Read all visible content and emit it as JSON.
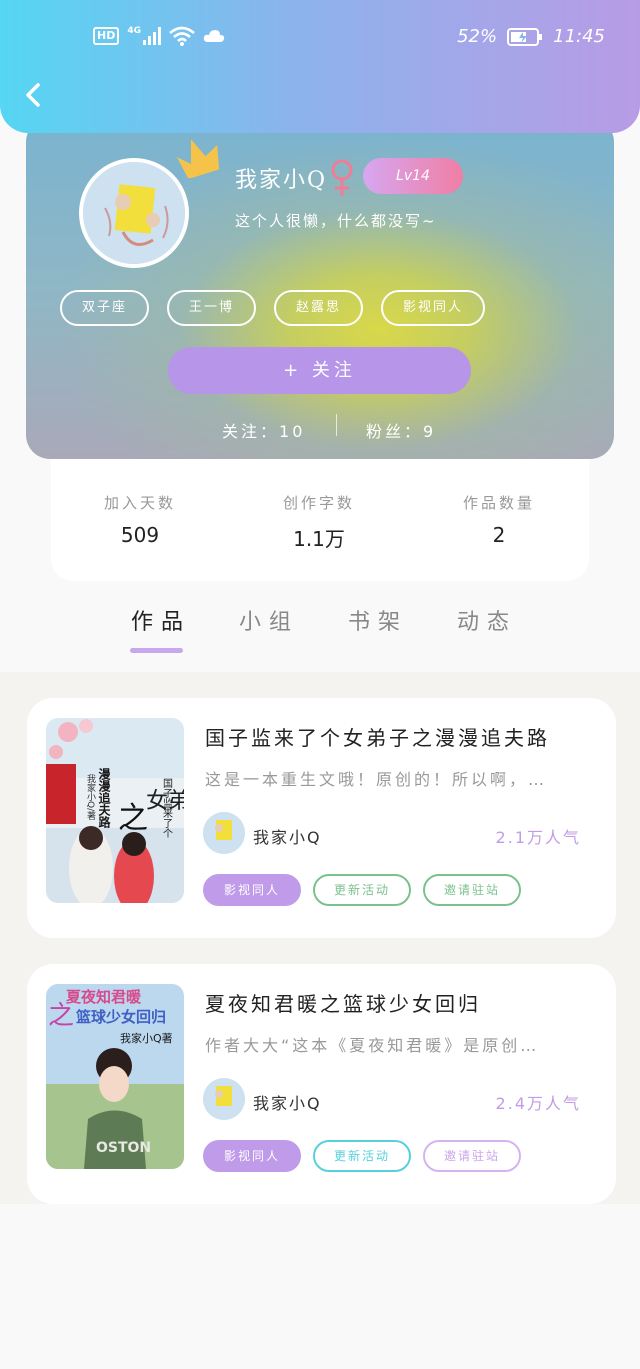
{
  "status_bar": {
    "network_badge": "HD",
    "network_type": "4G",
    "battery_percent": "52%",
    "time": "11:45",
    "icons": [
      "hd-icon",
      "signal-icon",
      "wifi-icon",
      "cloud-icon",
      "battery-icon"
    ]
  },
  "header": {
    "back_icon": "chevron-left-icon"
  },
  "profile": {
    "username": "我家小Q",
    "gender_symbol": "♀",
    "level": "Lv14",
    "bio": "这个人很懒，什么都没写~",
    "tags": [
      "双子座",
      "王一博",
      "赵露思",
      "影视同人"
    ],
    "follow_button": "+ 关注",
    "following_label": "关注：",
    "following_count": "10",
    "fans_label": "粉丝：",
    "fans_count": "9"
  },
  "stats": [
    {
      "label": "加入天数",
      "value": "509"
    },
    {
      "label": "创作字数",
      "value": "1.1万"
    },
    {
      "label": "作品数量",
      "value": "2"
    }
  ],
  "tabs": [
    {
      "label": "作品",
      "active": true
    },
    {
      "label": "小组",
      "active": false
    },
    {
      "label": "书架",
      "active": false
    },
    {
      "label": "动态",
      "active": false
    }
  ],
  "works": [
    {
      "title": "国子监来了个女弟子之漫漫追夫路",
      "description": "这是一本重生文哦！原创的！所以啊，…",
      "author": "我家小Q",
      "popularity": "2.1万人气",
      "cover_text": {
        "line1": "国子监来了个",
        "line2": "女弟子",
        "line3": "之",
        "line4": "漫漫追夫路",
        "author": "我家小Q/著"
      },
      "chips": [
        "影视同人",
        "更新活动",
        "邀请驻站"
      ]
    },
    {
      "title": "夏夜知君暖之篮球少女回归",
      "description": "作者大大“这本《夏夜知君暖》是原创…",
      "author": "我家小Q",
      "popularity": "2.4万人气",
      "cover_text": {
        "line1": "夏夜知君暖",
        "line2": "之",
        "line3": "篮球少女回归",
        "author": "我家小Q著",
        "shirt": "OSTON"
      },
      "chips": [
        "影视同人",
        "更新活动",
        "邀请驻站"
      ]
    }
  ],
  "colors": {
    "header_gradient_start": "#55d6f3",
    "header_gradient_end": "#b89be6",
    "accent_purple": "#b795e8",
    "popularity": "#c39be6"
  }
}
